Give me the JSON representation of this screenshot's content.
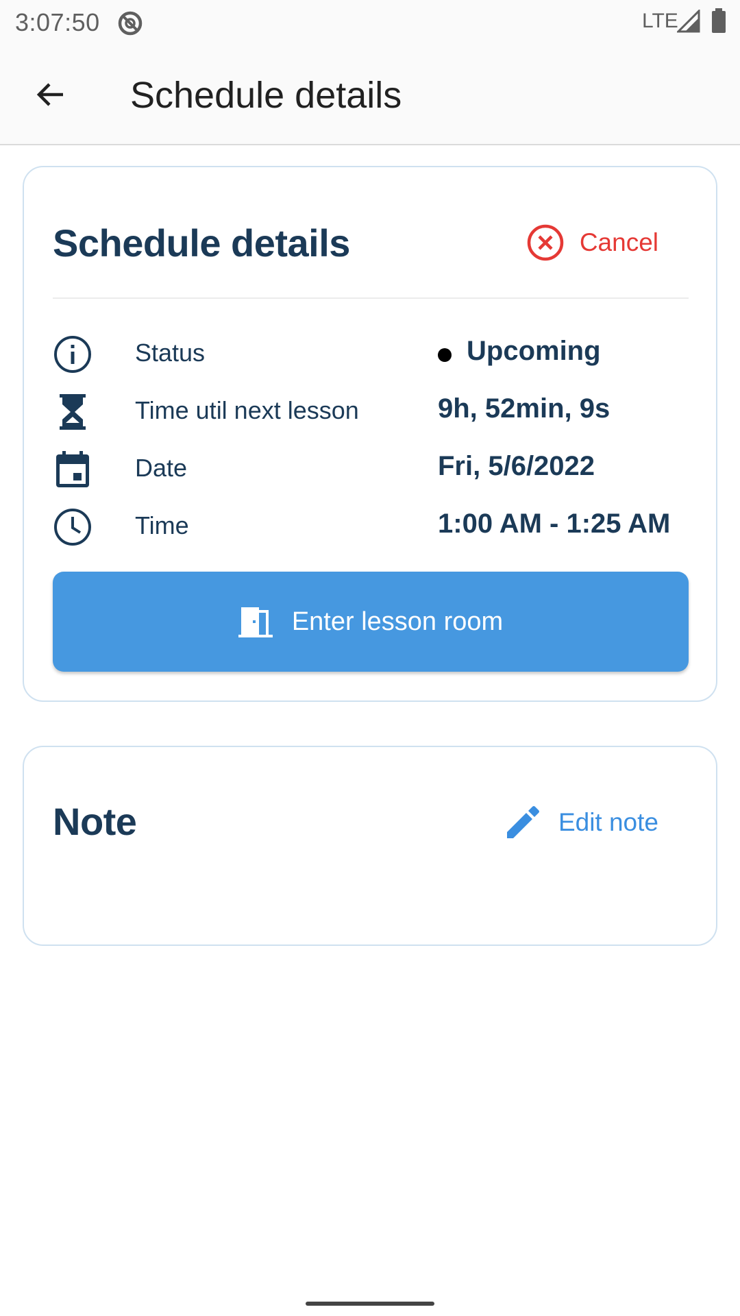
{
  "status_bar": {
    "time": "3:07:50",
    "network": "LTE"
  },
  "app_bar": {
    "title": "Schedule details"
  },
  "details_card": {
    "title": "Schedule details",
    "cancel_label": "Cancel",
    "rows": [
      {
        "icon": "info-icon",
        "label": "Status",
        "value": "Upcoming"
      },
      {
        "icon": "hourglass-icon",
        "label": "Time util next lesson",
        "value": "9h, 52min, 9s"
      },
      {
        "icon": "calendar-icon",
        "label": "Date",
        "value": "Fri, 5/6/2022"
      },
      {
        "icon": "clock-icon",
        "label": "Time",
        "value": "1:00 AM - 1:25 AM"
      }
    ],
    "enter_button_label": "Enter lesson room"
  },
  "note_card": {
    "title": "Note",
    "edit_label": "Edit note",
    "text": ""
  },
  "colors": {
    "primary_text": "#1b3a57",
    "accent_blue": "#4698e0",
    "cancel_red": "#e53935",
    "card_border": "#cfe1f0"
  }
}
